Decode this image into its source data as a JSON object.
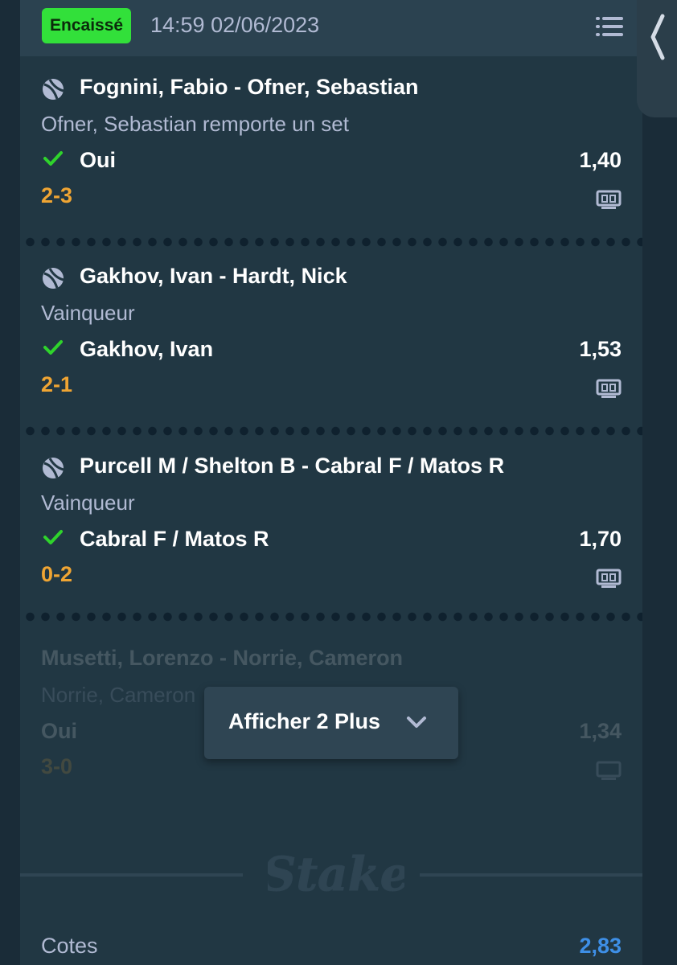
{
  "header": {
    "status_badge": "Encaissé",
    "timestamp": "14:59 02/06/2023"
  },
  "bets": [
    {
      "event": "Fognini, Fabio - Ofner, Sebastian",
      "market": "Ofner, Sebastian remporte un set",
      "selection": "Oui",
      "odds": "1,40",
      "score": "2-3"
    },
    {
      "event": "Gakhov, Ivan - Hardt, Nick",
      "market": "Vainqueur",
      "selection": "Gakhov, Ivan",
      "odds": "1,53",
      "score": "2-1"
    },
    {
      "event": "Purcell M / Shelton B - Cabral F / Matos R",
      "market": "Vainqueur",
      "selection": "Cabral F / Matos R",
      "odds": "1,70",
      "score": "0-2"
    },
    {
      "event": "Musetti, Lorenzo - Norrie, Cameron",
      "market": "Norrie, Cameron",
      "selection": "Oui",
      "odds": "1,34",
      "score": "3-0"
    }
  ],
  "show_more_label": "Afficher 2 Plus",
  "brand_logo": "Stake",
  "footer": {
    "odds_label": "Cotes",
    "odds_value": "2,83"
  },
  "colors": {
    "background": "#1a2c38",
    "panel": "#213743",
    "status_green": "#32e03a",
    "score_orange": "#f0a533",
    "odds_blue": "#3e8fe6",
    "check_green": "#1fff20"
  },
  "icons": {
    "menu": "list-menu-icon",
    "side_tab": "chevron-left-icon",
    "event": "tennis-ball-icon",
    "result": "check-icon",
    "score": "scoreboard-icon",
    "show_more": "chevron-down-icon"
  }
}
